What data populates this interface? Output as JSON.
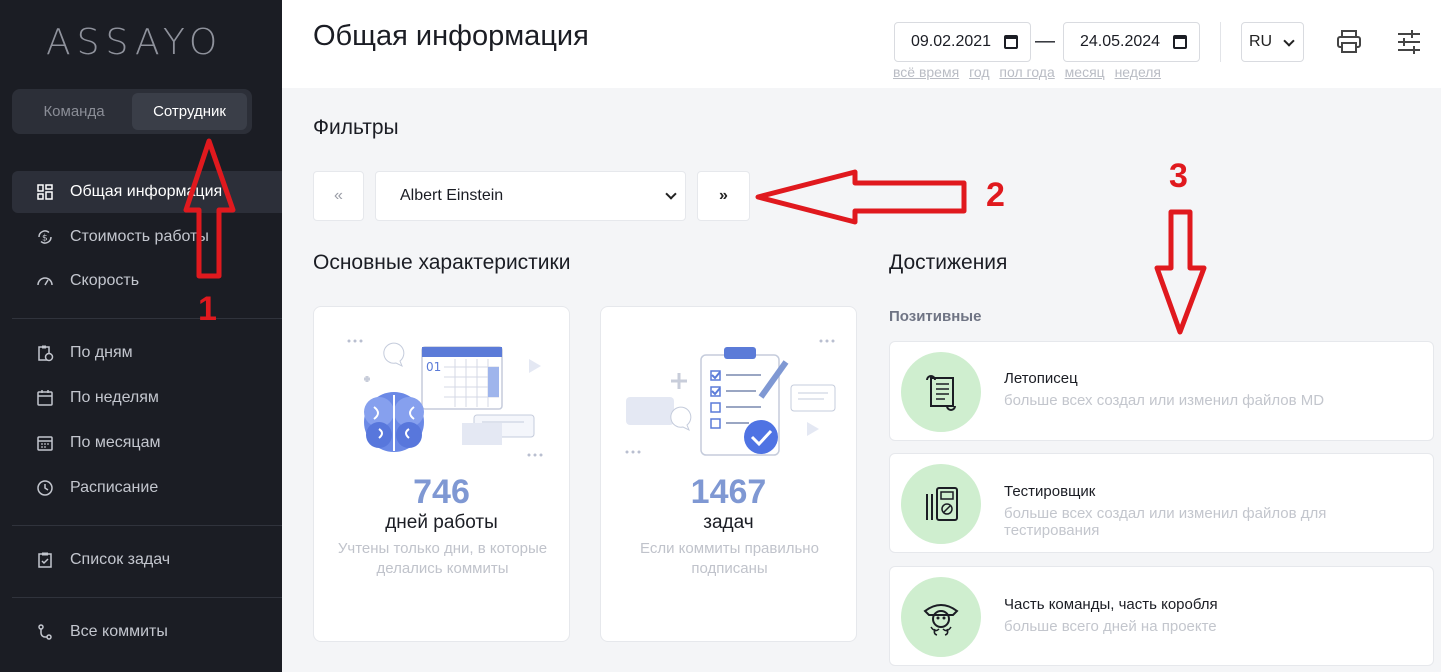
{
  "sidebar": {
    "logo": "ASSAYO",
    "switcher": {
      "team": "Команда",
      "employee": "Сотрудник"
    },
    "items": [
      {
        "label": "Общая информация",
        "icon": "dashboard-icon"
      },
      {
        "label": "Стоимость работы",
        "icon": "currency-cycle-icon"
      },
      {
        "label": "Скорость",
        "icon": "speedometer-icon"
      },
      {
        "label": "По дням",
        "icon": "clipboard-clock-icon"
      },
      {
        "label": "По неделям",
        "icon": "calendar-icon"
      },
      {
        "label": "По месяцам",
        "icon": "calendar-grid-icon"
      },
      {
        "label": "Расписание",
        "icon": "clock-icon"
      },
      {
        "label": "Список задач",
        "icon": "clipboard-check-icon"
      },
      {
        "label": "Все коммиты",
        "icon": "git-commit-icon"
      }
    ]
  },
  "header": {
    "title": "Общая информация",
    "date_from": "09.02.2021",
    "date_sep": "—",
    "date_to": "24.05.2024",
    "quick_ranges": [
      "всё время",
      "год",
      "пол года",
      "месяц",
      "неделя"
    ],
    "language": "RU"
  },
  "filters": {
    "title": "Фильтры",
    "prev": "«",
    "next": "»",
    "selected_employee": "Albert Einstein"
  },
  "main": {
    "characteristics_title": "Основные характеристики",
    "cards": [
      {
        "value": "746",
        "unit": "дней работы",
        "note": "Учтены только дни, в которые делались коммиты"
      },
      {
        "value": "1467",
        "unit": "задач",
        "note": "Если коммиты правильно подписаны"
      }
    ]
  },
  "achievements": {
    "title": "Достижения",
    "positive_label": "Позитивные",
    "items": [
      {
        "title": "Летописец",
        "desc": "больше всех создал или изменил файлов MD",
        "icon": "scroll-icon"
      },
      {
        "title": "Тестировщик",
        "desc": "больше всех создал или изменил файлов для тестирования",
        "icon": "multimeter-icon"
      },
      {
        "title": "Часть команды, часть коробля",
        "desc": "больше всего дней на проекте",
        "icon": "pirate-icon"
      }
    ]
  },
  "annotations": [
    "1",
    "2",
    "3"
  ],
  "colors": {
    "sidebar_bg": "#1b1d24",
    "accent_number": "#7f98d3",
    "badge_green": "#cfeecf",
    "annotation_red": "#e0191e"
  }
}
